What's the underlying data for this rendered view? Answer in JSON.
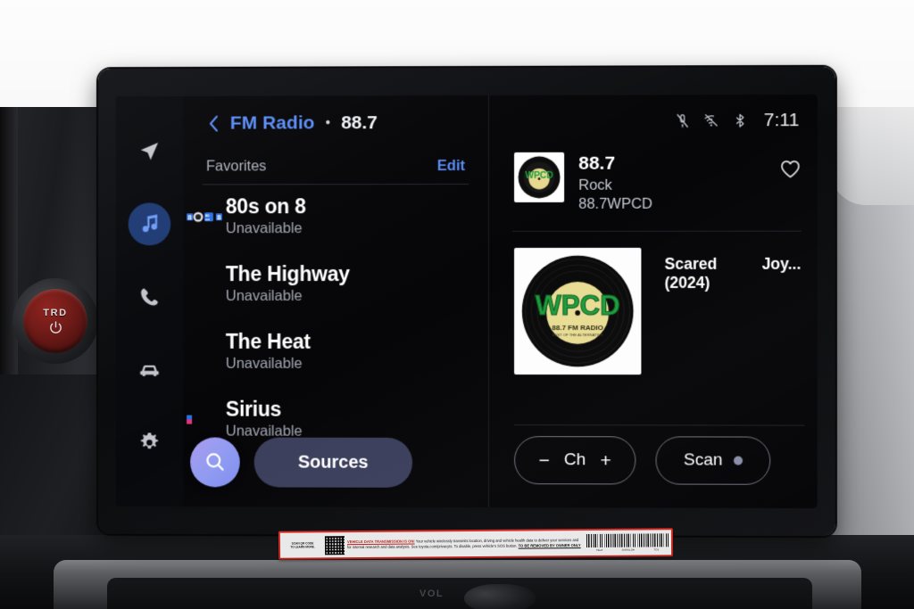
{
  "vehicle": {
    "start_button_label": "TRD",
    "volume_label": "VOL",
    "warning_label": {
      "scan_line1": "SCAN QR CODE",
      "scan_line2": "TO LEARN MORE.",
      "headline": "VEHICLE DATA TRANSMISSION IS ON!",
      "body": " Your vehicle wirelessly transmits location, driving and vehicle health data to deliver your services and for internal research and data analysis. See toyota.com/privacyts. To disable, press vehicle's SOS button. ",
      "footer": "TO BE REMOVED BY OWNER ONLY",
      "barcode_labels": [
        "TEL#",
        "DATA/LO#",
        "TO1"
      ]
    }
  },
  "sidebar": {
    "items": [
      {
        "name": "navigation",
        "icon": "navigation-arrow-icon",
        "active": false
      },
      {
        "name": "media",
        "icon": "music-note-icon",
        "active": true
      },
      {
        "name": "phone",
        "icon": "phone-icon",
        "active": false
      },
      {
        "name": "vehicle",
        "icon": "car-icon",
        "active": false
      },
      {
        "name": "settings",
        "icon": "gear-icon",
        "active": false
      }
    ]
  },
  "left_panel": {
    "back_icon": "chevron-left-icon",
    "source_title": "FM Radio",
    "separator": "•",
    "frequency": "88.7",
    "favorites_label": "Favorites",
    "edit_label": "Edit",
    "favorites": [
      {
        "name": "80s on 8",
        "status": "Unavailable",
        "has_logo": true,
        "logo_text": "80s on 8"
      },
      {
        "name": "The Highway",
        "status": "Unavailable",
        "has_logo": false
      },
      {
        "name": "The Heat",
        "status": "Unavailable",
        "has_logo": false
      },
      {
        "name": "Sirius",
        "status": "Unavailable",
        "has_logo": true,
        "logo_text": "SiriusXM"
      }
    ],
    "search_icon": "search-icon",
    "sources_label": "Sources"
  },
  "status_bar": {
    "mic_muted_icon": "microphone-muted-icon",
    "wifi_off_icon": "wifi-off-icon",
    "bluetooth_icon": "bluetooth-icon",
    "time": "7:11"
  },
  "now_playing": {
    "station": {
      "art_text": "WPCD",
      "frequency": "88.7",
      "genre": "Rock",
      "call_sign": "88.7WPCD",
      "favorite_icon": "heart-outline-icon"
    },
    "album_art_text": "WPCD",
    "album_art_sub": "88.7 FM RADIO",
    "track_title": "Scared (2024)",
    "artist": "Joy..."
  },
  "controls": {
    "channel_down": "−",
    "channel_label": "Ch",
    "channel_up": "+",
    "scan_label": "Scan",
    "scan_indicator": "scan-dot-icon"
  },
  "colors": {
    "accent_blue": "#5a8cf5",
    "sidebar_active": "#1e3a73",
    "search_fab": "#8f9bf1",
    "sources_pill": "#3b3f5c",
    "warning_red": "#b8241c",
    "trd_red": "#6d1a17",
    "station_green": "#1f9d3d"
  }
}
